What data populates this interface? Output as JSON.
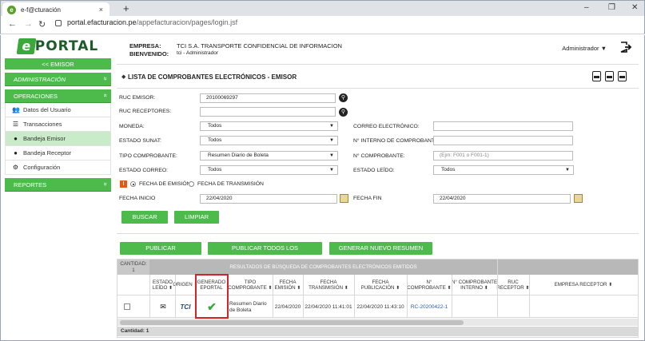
{
  "browser": {
    "tab_title": "e-f@cturación",
    "tab_close": "×",
    "new_tab": "+",
    "url_domain": "portal.efacturacion.pe",
    "url_path": "/appefacturacion/pages/login.jsf",
    "window_minimize": "–",
    "window_maximize": "❐",
    "window_close": "✕"
  },
  "sidebar": {
    "logo_letter": "e",
    "logo_text": "PORTAL",
    "back_button": "<< EMISOR",
    "sections": [
      {
        "label": "ADMINISTRACIÓN",
        "chevron": "»"
      },
      {
        "label": "OPERACIONES",
        "chevron": "«"
      },
      {
        "label": "REPORTES",
        "chevron": "»"
      }
    ],
    "items": [
      {
        "label": "Datos del Usuario",
        "icon": "users-icon"
      },
      {
        "label": "Transacciones",
        "icon": "list-icon"
      },
      {
        "label": "Bandeja Emisor",
        "icon": "circle-icon"
      },
      {
        "label": "Bandeja Receptor",
        "icon": "circle-icon"
      },
      {
        "label": "Configuración",
        "icon": "gears-icon"
      }
    ]
  },
  "header": {
    "empresa_label": "EMPRESA:",
    "empresa_value": "TCI S.A. TRANSPORTE CONFIDENCIAL DE INFORMACION",
    "bienvenido_label": "BIENVENIDO:",
    "bienvenido_value": "tci - Administrador",
    "user_menu": "Administrador ▼"
  },
  "page_title": "LISTA DE COMPROBANTES ELECTRÓNICOS - EMISOR",
  "form": {
    "ruc_emisor_label": "RUC EMISOR:",
    "ruc_emisor_value": "20100069297",
    "ruc_receptores_label": "RUC RECEPTORES:",
    "ruc_receptores_value": "",
    "moneda_label": "MONEDA:",
    "moneda_value": "Todos",
    "correo_electronico_label": "CORREO ELECTRÓNICO:",
    "correo_electronico_value": "",
    "estado_sunat_label": "ESTADO SUNAT:",
    "estado_sunat_value": "Todos",
    "interno_label": "N° INTERNO DE COMPROBANTE:",
    "interno_value": "",
    "tipo_comprobante_label": "TIPO COMPROBANTE:",
    "tipo_comprobante_value": "Resumen Diario de Boleta",
    "n_comprobante_label": "N° COMPROBANTE:",
    "n_comprobante_placeholder": "(Ejm: F001 o F001-1)",
    "estado_correo_label": "ESTADO CORREO:",
    "estado_correo_value": "Todos",
    "estado_leido_label": "ESTADO LEÍDO:",
    "estado_leido_value": "Todos",
    "info_badge": "!",
    "radio_emision": "FECHA DE EMISIÓN",
    "radio_transmision": "FECHA DE TRANSMISIÓN",
    "fecha_inicio_label": "FECHA INICIO",
    "fecha_inicio_value": "22/04/2020",
    "fecha_fin_label": "FECHA FIN",
    "fecha_fin_value": "22/04/2020",
    "buscar": "BUSCAR",
    "limpiar": "LIMPIAR"
  },
  "actions": {
    "publicar": "PUBLICAR COMPROBANTES",
    "publicar_todos": "PUBLICAR TODOS LOS COMPROBANTES",
    "generar": "GENERAR NUEVO RESUMEN DIARIO"
  },
  "results": {
    "cantidad_header": "CANTIDAD:\n1",
    "group_header": "RESULTADOS DE BÚSQUEDA DE COMPROBANTES ELECTRÓNICOS EMITIDOS",
    "columns": [
      "ESTADO\nLEÍDO ⬍",
      "ORIGEN ⬍",
      "GENERADO\nEPORTAL",
      "TIPO\nCOMPROBANTE ⬍",
      "FECHA\nEMISIÓN ⬍",
      "FECHA\nTRANSMISIÓN ⬍",
      "FECHA\nPUBLICACIÓN ⬍",
      "N°\nCOMPROBANTE ⬍",
      "N° COMPROBANTE\nINTERNO ⬍",
      "RUC\nRECEPTOR ⬍",
      "EMPRESA RECEPTOR ⬍"
    ],
    "row": {
      "origen": "TCI",
      "tipo": "Resumen Diario\nde Boleta",
      "fecha_emision": "22/04/2020",
      "fecha_transmision": "22/04/2020 11:41:01",
      "fecha_publicacion": "22/04/2020 11:43:10",
      "n_comprobante": "RC-20200422-1",
      "n_interno": "",
      "ruc_receptor": "",
      "empresa_receptor": ""
    },
    "footer": "Cantidad: 1"
  },
  "colors": {
    "accent_green": "#4cbb4c",
    "highlight_red": "#d0262a",
    "link_blue": "#2a5db0"
  }
}
